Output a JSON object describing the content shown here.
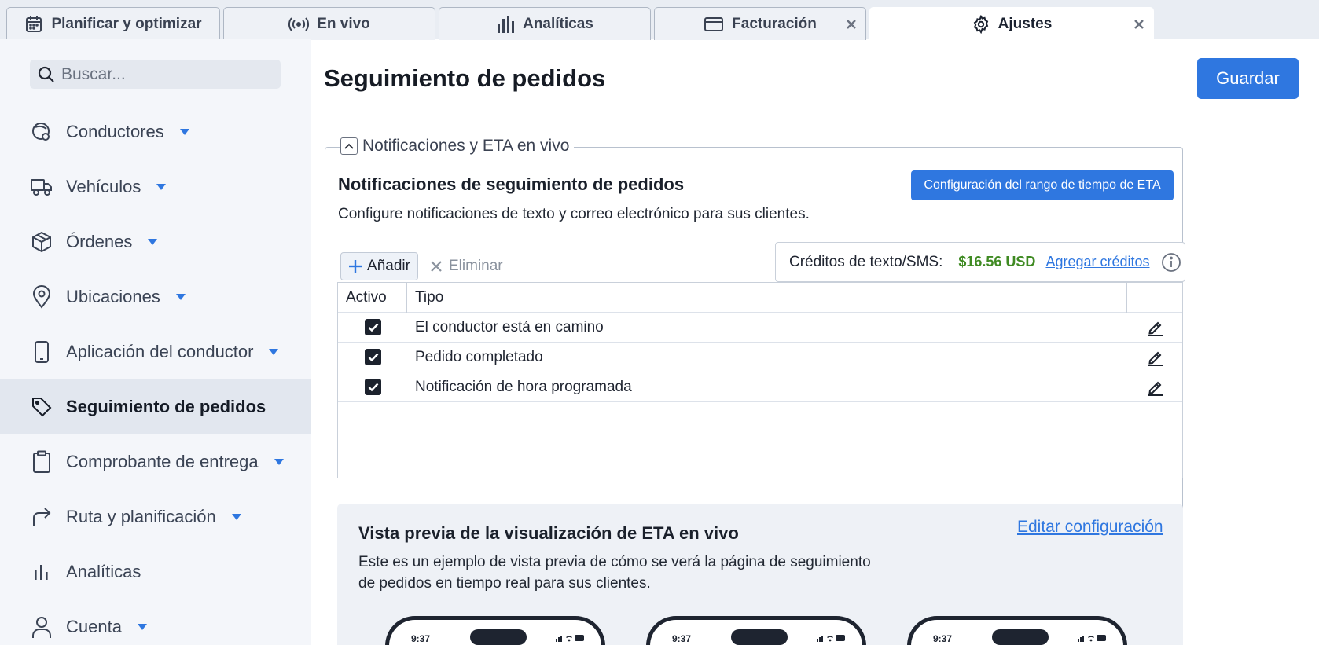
{
  "tabs": [
    {
      "label": "Planificar y optimizar",
      "icon": "calendar-icon",
      "closable": false,
      "active": false
    },
    {
      "label": "En vivo",
      "icon": "broadcast-icon",
      "closable": false,
      "active": false
    },
    {
      "label": "Analíticas",
      "icon": "bar-chart-icon",
      "closable": false,
      "active": false
    },
    {
      "label": "Facturación",
      "icon": "credit-card-icon",
      "closable": true,
      "active": false
    },
    {
      "label": "Ajustes",
      "icon": "gear-icon",
      "closable": true,
      "active": true
    }
  ],
  "sidebar": {
    "search_placeholder": "Buscar...",
    "items": [
      {
        "label": "Conductores",
        "icon": "driver-icon",
        "has_dropdown": true
      },
      {
        "label": "Vehículos",
        "icon": "truck-icon",
        "has_dropdown": true
      },
      {
        "label": "Órdenes",
        "icon": "package-icon",
        "has_dropdown": true
      },
      {
        "label": "Ubicaciones",
        "icon": "map-pin-icon",
        "has_dropdown": true
      },
      {
        "label": "Aplicación del conductor",
        "icon": "phone-icon",
        "has_dropdown": true
      },
      {
        "label": "Seguimiento de pedidos",
        "icon": "tag-icon",
        "has_dropdown": false,
        "active": true
      },
      {
        "label": "Comprobante de entrega",
        "icon": "clipboard-icon",
        "has_dropdown": true
      },
      {
        "label": "Ruta y planificación",
        "icon": "route-arrow-icon",
        "has_dropdown": true
      },
      {
        "label": "Analíticas",
        "icon": "bar-chart-icon",
        "has_dropdown": false
      },
      {
        "label": "Cuenta",
        "icon": "user-icon",
        "has_dropdown": true
      }
    ]
  },
  "main": {
    "title": "Seguimiento de pedidos",
    "save_label": "Guardar",
    "section_legend": "Notificaciones y ETA en vivo",
    "section_title": "Notificaciones de seguimiento de pedidos",
    "section_subtitle": "Configure notificaciones de texto y correo electrónico para sus clientes.",
    "eta_button_label": "Configuración del rango de tiempo de ETA",
    "add_label": "Añadir",
    "delete_label": "Eliminar",
    "credits": {
      "label": "Créditos de texto/SMS:",
      "value": "$16.56 USD",
      "link": "Agregar créditos"
    },
    "table": {
      "headers": [
        "Activo",
        "Tipo"
      ],
      "rows": [
        {
          "active": true,
          "type": "El conductor está en camino"
        },
        {
          "active": true,
          "type": "Pedido completado"
        },
        {
          "active": true,
          "type": "Notificación de hora programada"
        }
      ]
    },
    "preview": {
      "title": "Vista previa de la visualización de ETA en vivo",
      "edit_link": "Editar configuración",
      "description": "Este es un ejemplo de vista previa de cómo se verá la página de seguimiento de pedidos en tiempo real para sus clientes.",
      "phone_time": "9:37"
    }
  },
  "colors": {
    "accent": "#2f77e0",
    "credits_value": "#3f8a22",
    "sidebar_bg": "#f4f6fa",
    "sidebar_active_bg": "#e2e7ef"
  }
}
